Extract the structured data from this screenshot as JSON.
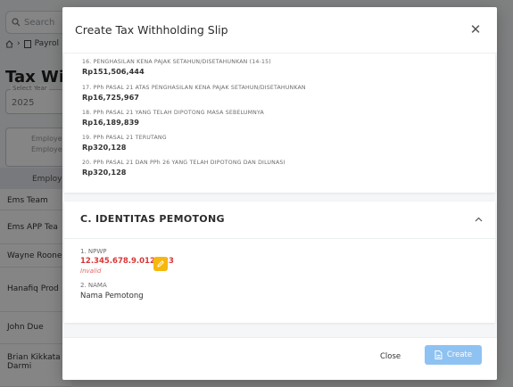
{
  "background": {
    "search_placeholder": "Search",
    "breadcrumb": "Payrol",
    "page_title": "Tax With",
    "year_label": "Select Year",
    "year_value": "2025",
    "filter_text": "Employee Employee",
    "column_header": "Employe",
    "employees": [
      "Ems Team",
      "Ems APP Tea",
      "Wayne Roone",
      "Hanafiq Prod",
      "John Due",
      "Brian Kikkata Darmi"
    ]
  },
  "modal": {
    "title": "Create Tax Withholding Slip",
    "close_icon": "close-icon",
    "info_items": [
      {
        "label": "16. PENGHASILAN KENA PAJAK SETAHUN/DISETAHUNKAN (14-15)",
        "value": "Rp151,506,444"
      },
      {
        "label": "17. PPh PASAL 21 ATAS PENGHASILAN KENA PAJAK SETAHUN/DISETAHUNKAN",
        "value": "Rp16,725,967"
      },
      {
        "label": "18. PPh PASAL 21 YANG TELAH DIPOTONG MASA SEBELUMNYA",
        "value": "Rp16,189,839"
      },
      {
        "label": "19. PPh PASAL 21 TERUTANG",
        "value": "Rp320,128"
      },
      {
        "label": "20. PPh PASAL 21 DAN PPh 26 YANG TELAH DIPOTONG DAN DILUNASI",
        "value": "Rp320,128"
      }
    ],
    "section": {
      "title": "C. IDENTITAS PEMOTONG",
      "npwp_label": "1. NPWP",
      "npwp_value": "12.345.678.9.012.123",
      "npwp_error": "Invalid",
      "name_label": "2. NAMA",
      "name_value": "Nama Pemotong"
    },
    "footer": {
      "close_label": "Close",
      "create_label": "Create"
    }
  },
  "colors": {
    "overlay": "#000000",
    "error": "#d93838",
    "edit_button": "#f5b80f",
    "create_button": "#8ec2f2"
  }
}
